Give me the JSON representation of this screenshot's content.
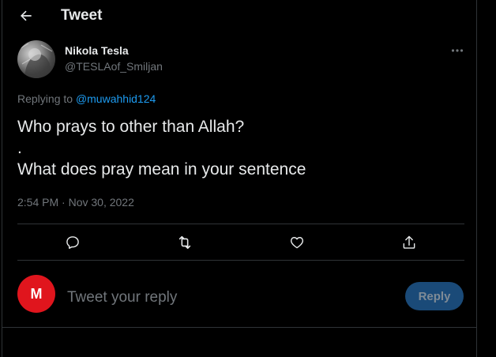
{
  "header": {
    "title": "Tweet",
    "back_icon": "arrow-left-icon"
  },
  "tweet": {
    "author_name": "Nikola Tesla",
    "author_handle": "@TESLAof_Smiljan",
    "replying_prefix": "Replying to ",
    "replying_to": "@muwahhid124",
    "lines": [
      "Who prays to other than Allah?",
      ".",
      "What does pray mean in your sentence"
    ],
    "timestamp": "2:54 PM · Nov 30, 2022",
    "more_icon": "more-horizontal-icon"
  },
  "actions": [
    {
      "name": "reply-action",
      "icon": "comment-icon"
    },
    {
      "name": "retweet-action",
      "icon": "retweet-icon"
    },
    {
      "name": "like-action",
      "icon": "heart-icon"
    },
    {
      "name": "share-action",
      "icon": "share-icon"
    }
  ],
  "composer": {
    "avatar_letter": "M",
    "placeholder": "Tweet your reply",
    "reply_label": "Reply"
  },
  "colors": {
    "background": "#000000",
    "text": "#e7e9ea",
    "muted": "#71767b",
    "link": "#1d9bf0",
    "reply_button": "#1a4a78",
    "user_avatar": "#e0151d"
  }
}
